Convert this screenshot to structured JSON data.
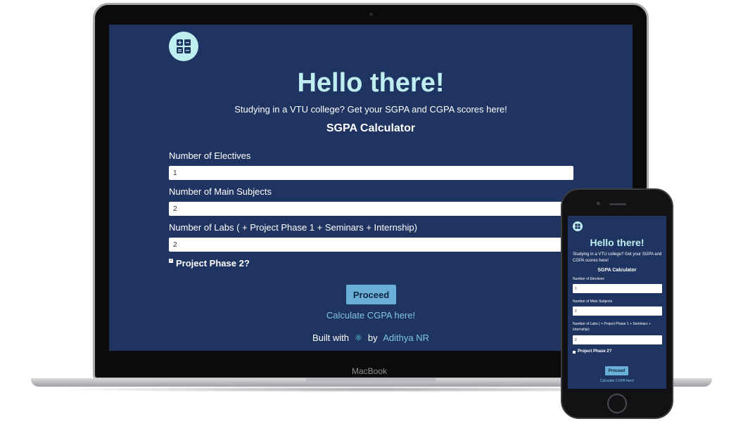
{
  "laptop": {
    "brand": "MacBook",
    "page": {
      "title": "Hello there!",
      "subtitle": "Studying in a VTU college? Get your SGPA and CGPA scores here!",
      "calculator_title": "SGPA Calculator",
      "fields": [
        {
          "label": "Number of Electives",
          "value": "1"
        },
        {
          "label": "Number of Main Subjects",
          "value": "2"
        },
        {
          "label": "Number of Labs ( + Project Phase 1 + Seminars + Internship)",
          "value": "2"
        }
      ],
      "checkbox_label": "Project Phase 2?",
      "proceed_label": "Proceed",
      "cgpa_link": "Calculate CGPA here!",
      "footer": {
        "built_with": "Built with",
        "react_icon": "⚛",
        "by": "by",
        "author": "Adithya NR"
      }
    }
  },
  "phone": {
    "page": {
      "title": "Hello there!",
      "subtitle": "Studying in a VTU college? Get your SGPA and CGPA scores here!",
      "calculator_title": "SGPA Calculator",
      "fields": [
        {
          "label": "Number of Electives",
          "value": "1"
        },
        {
          "label": "Number of Main Subjects",
          "value": "2"
        },
        {
          "label": "Number of Labs ( + Project Phase 1 + Seminars + Internship)",
          "value": "2"
        }
      ],
      "checkbox_label": "Project Phase 2?",
      "proceed_label": "Proceed",
      "cgpa_link": "Calculate CGPA here!"
    }
  },
  "colors": {
    "background": "#1f3460",
    "accent": "#bfeef0",
    "button": "#6aafd6",
    "link": "#7fc4e8"
  }
}
